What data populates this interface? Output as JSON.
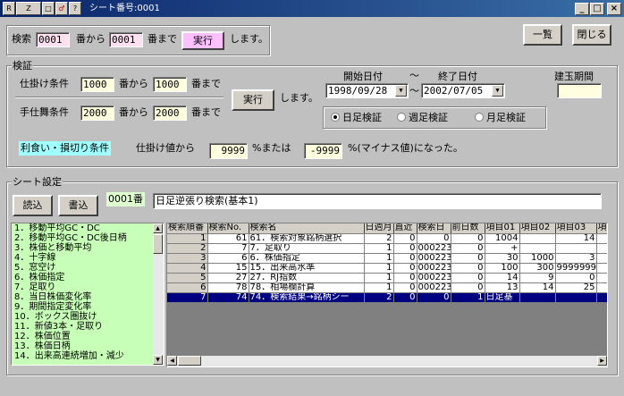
{
  "window": {
    "icons": [
      "R",
      "Z",
      "□",
      "♂",
      "?"
    ],
    "title": "シート番号:0001",
    "controls": [
      "_",
      "□",
      "×"
    ]
  },
  "search": {
    "label": "検索",
    "from_value": "0001",
    "from_suffix": "番から",
    "to_value": "0001",
    "to_suffix": "番まで",
    "run_label": "実行",
    "tail": "します。"
  },
  "top_buttons": {
    "list": "一覧",
    "close": "閉じる"
  },
  "verify": {
    "title": "検証",
    "cond1_label": "仕掛け条件",
    "cond1_from": "1000",
    "cond1_from_suffix": "番から",
    "cond1_to": "1000",
    "cond1_to_suffix": "番まで",
    "cond2_label": "手仕舞条件",
    "cond2_from": "2000",
    "cond2_from_suffix": "番から",
    "cond2_to": "2000",
    "cond2_to_suffix": "番まで",
    "run_label": "実行",
    "tail": "します。",
    "start_label": "開始日付",
    "tilde": "～",
    "end_label": "終了日付",
    "start_date": "1998/09/28",
    "range_tilde": "～",
    "end_date": "2002/07/05",
    "period_label": "建玉期間",
    "period_value": "",
    "radio_daily": "日足検証",
    "radio_weekly": "週足検証",
    "radio_monthly": "月足検証",
    "radio_selected": "daily"
  },
  "profit_loss": {
    "badge": "利食い・損切り条件",
    "prefix": "仕掛け値から",
    "value1": "9999",
    "mid": "%または",
    "value2": "-9999",
    "suffix": "%(マイナス値)になった。"
  },
  "sheet": {
    "title": "シート設定",
    "read_label": "読込",
    "write_label": "書込",
    "number": "0001番",
    "name": "日足逆張り検索(基本1)"
  },
  "list_items": [
    "1．移動平均GC・DC",
    "2．移動平均GC・DC後日柄",
    "3．株価と移動平均",
    "4．十字線",
    "5．窓空け",
    "6．株価指定",
    "7．足取り",
    "8．当日株価変化率",
    "9．期間指定変化率",
    "10．ボックス圏抜け",
    "11．新値3本・足取り",
    "12．株価位置",
    "13．株価日柄",
    "14．出来高連続増加・減少"
  ],
  "grid": {
    "headers": [
      "検索順番",
      "検索No.",
      "検索名",
      "日週月",
      "直近",
      "検索日",
      "前日数",
      "項目01",
      "項目02",
      "項目03",
      "項"
    ],
    "rows": [
      [
        "1",
        "61",
        "61．検索対象銘柄選択",
        "2",
        "0",
        "0",
        "0",
        "1004",
        "",
        "14",
        ""
      ],
      [
        "2",
        "7",
        "7．足取り",
        "1",
        "0",
        "000223",
        "0",
        "+",
        "",
        "",
        ""
      ],
      [
        "3",
        "6",
        "6．株価指定",
        "1",
        "0",
        "000223",
        "0",
        "30",
        "1000",
        "3",
        ""
      ],
      [
        "4",
        "15",
        "15．出来高水準",
        "1",
        "0",
        "000223",
        "0",
        "100",
        "300",
        "9999999",
        ""
      ],
      [
        "5",
        "27",
        "27．RJ指数",
        "1",
        "0",
        "000223",
        "0",
        "14",
        "9",
        "0",
        ""
      ],
      [
        "6",
        "78",
        "78．相場欄計算",
        "1",
        "0",
        "000223",
        "0",
        "13",
        "14",
        "25",
        ""
      ],
      [
        "7",
        "74",
        "74．検索結果→銘柄シー",
        "2",
        "0",
        "0",
        "1",
        "日足基",
        "",
        "",
        ""
      ]
    ],
    "selected_row": 6
  }
}
